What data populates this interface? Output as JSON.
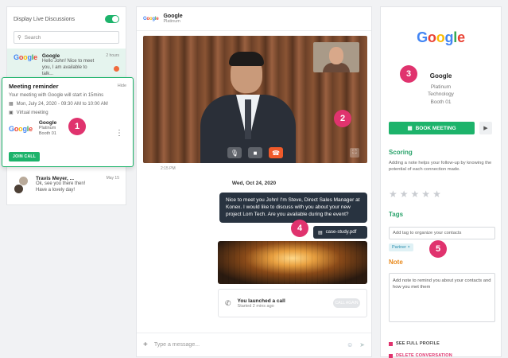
{
  "left_panel": {
    "toggle_label": "Display Live Discussions",
    "search_placeholder": "Search",
    "conversations": [
      {
        "name": "Google",
        "message": "Hello John! Nice to meet you, I am available to talk...",
        "time": "2 hours"
      },
      {
        "name": "Travis Meyer, ...",
        "message": "Ok, see you there then! Have a lovely day!",
        "time": "May 15"
      }
    ]
  },
  "reminder": {
    "title": "Meeting reminder",
    "hide_label": "Hide",
    "message": "Your meeting with Google will start in 15mins",
    "datetime": "Mon, July 24, 2020 - 09:30 AM to 10:00 AM",
    "location": "Virtual meeting",
    "company": "Google",
    "company_sub1": "Platinum",
    "company_sub2": "Booth 01",
    "join_label": "JOIN CALL"
  },
  "chat": {
    "header_name": "Google",
    "header_sub": "Platinum",
    "video_timestamp": "2:15 PM",
    "date_label": "Wed, Oct 24, 2020",
    "message": "Nice to meet you John! I'm Steve, Direct Sales Manager at Konex. I would like to discuss with you about your new project Lom Tech. Are you available during the event?",
    "file_name": "case-study.pdf",
    "call_title": "You launched a call",
    "call_sub": "Started 2 mins ago",
    "call_again": "CALL AGAIN",
    "composer_placeholder": "Type a message..."
  },
  "profile": {
    "name": "Google",
    "sub1": "Platinum",
    "sub2": "Technology",
    "sub3": "Booth 01",
    "book_label": "BOOK MEETING",
    "scoring_title": "Scoring",
    "scoring_desc": "Adding a note helps your follow-up by knowing the potential of each connection made.",
    "tags_title": "Tags",
    "tags_placeholder": "Add tag to organize your contacts",
    "tag_chip": "Partner ×",
    "note_title": "Note",
    "note_placeholder": "Add note to remind you about your contacts and how you met them",
    "see_profile": "SEE FULL PROFILE",
    "delete_label": "DELETE CONVERSATION"
  },
  "markers": [
    "1",
    "2",
    "3",
    "4",
    "5"
  ],
  "colors": {
    "accent": "#1db36b",
    "marker": "#e0336e",
    "dark_bubble": "#283340",
    "note_orange": "#e8891c"
  }
}
